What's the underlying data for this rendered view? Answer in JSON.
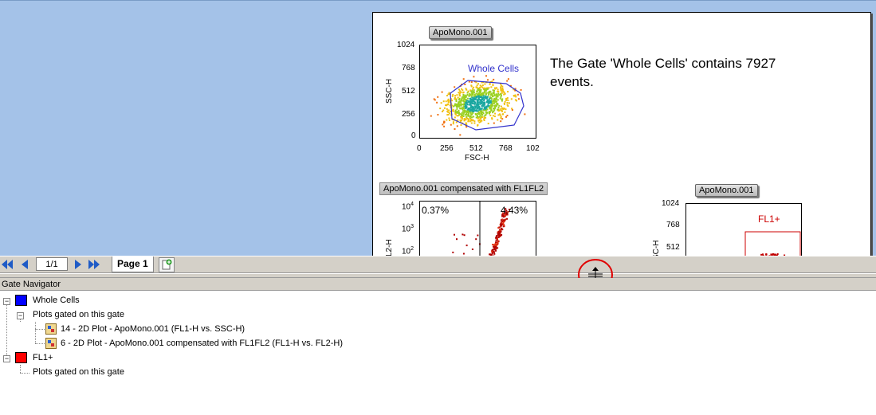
{
  "layout_page": {
    "plot1": {
      "tag": "ApoMono.001",
      "y_ticks": [
        "1024",
        "768",
        "512",
        "256",
        "0"
      ],
      "x_ticks": [
        "0",
        "256",
        "512",
        "768",
        "102"
      ],
      "x_title": "FSC-H",
      "y_title": "SSC-H",
      "gate_label": "Whole Cells"
    },
    "info_text": "The Gate 'Whole Cells' contains 7927 events.",
    "plot2": {
      "tag": "ApoMono.001 compensated with FL1FL2",
      "y_ticks": [
        "10",
        "10",
        "10"
      ],
      "y_exps": [
        "4",
        "3",
        "2"
      ],
      "y_title": "L2-H",
      "quad_upper_left": "0.37%",
      "quad_upper_right": "4.43%"
    },
    "plot3": {
      "tag": "ApoMono.001",
      "y_ticks": [
        "1024",
        "768",
        "512"
      ],
      "y_title": "SC-H",
      "gate_label": "FL1+"
    }
  },
  "toolbar": {
    "pager": "1/1",
    "page_tab": "Page 1"
  },
  "gate_navigator": {
    "title": "Gate Navigator",
    "gates": [
      {
        "name": "Whole Cells",
        "color": "#0000ff",
        "group_label": "Plots gated on this gate",
        "plots": [
          "14 - 2D Plot - ApoMono.001 (FL1-H vs. SSC-H)",
          "6 - 2D Plot - ApoMono.001 compensated with FL1FL2 (FL1-H vs. FL2-H)"
        ]
      },
      {
        "name": "FL1+",
        "color": "#ff0000",
        "group_label": "Plots gated on this gate",
        "plots": []
      }
    ]
  },
  "colors": {
    "workspace_bg": "#a4c2e8",
    "gate_whole_cells": "#3333cc",
    "gate_fl1": "#cc0000",
    "highlight_circle": "#e00000"
  },
  "icons": {
    "first": "double-left-arrow-icon",
    "prev": "left-arrow-icon",
    "next": "right-arrow-icon",
    "last": "double-right-arrow-icon",
    "add_page": "add-page-icon",
    "resize": "vertical-resize-icon",
    "plot": "2d-plot-icon"
  }
}
